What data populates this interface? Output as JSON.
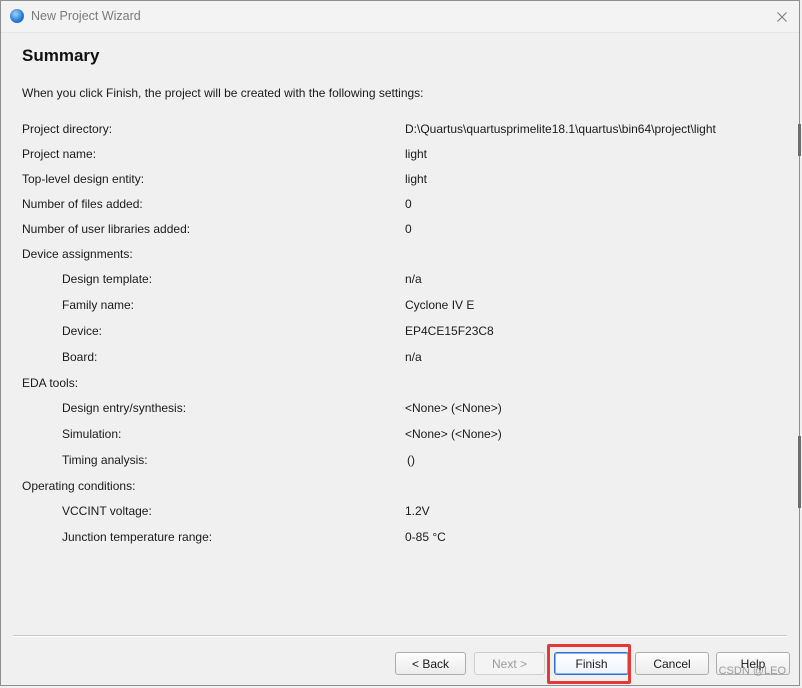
{
  "window": {
    "title": "New Project Wizard"
  },
  "page": {
    "heading": "Summary",
    "intro": "When you click Finish, the project will be created with the following settings:"
  },
  "settings": [
    {
      "label": "Project directory:",
      "value": "D:\\Quartus\\quartusprimelite18.1\\quartus\\bin64\\project\\light",
      "indent": false
    },
    {
      "label": "Project name:",
      "value": "light",
      "indent": false
    },
    {
      "label": "Top-level design entity:",
      "value": "light",
      "indent": false
    },
    {
      "label": "Number of files added:",
      "value": "0",
      "indent": false
    },
    {
      "label": "Number of user libraries added:",
      "value": "0",
      "indent": false
    },
    {
      "label": "Device assignments:",
      "value": "",
      "indent": false
    },
    {
      "label": "Design template:",
      "value": "n/a",
      "indent": true
    },
    {
      "label": "Family name:",
      "value": "Cyclone IV E",
      "indent": true
    },
    {
      "label": "Device:",
      "value": "EP4CE15F23C8",
      "indent": true
    },
    {
      "label": "Board:",
      "value": "n/a",
      "indent": true
    },
    {
      "label": "EDA tools:",
      "value": "",
      "indent": false
    },
    {
      "label": "Design entry/synthesis:",
      "value": "<None> (<None>)",
      "indent": true
    },
    {
      "label": "Simulation:",
      "value": "<None> (<None>)",
      "indent": true
    },
    {
      "label": "Timing analysis:",
      "value": "()",
      "indent": true
    },
    {
      "label": "Operating conditions:",
      "value": "",
      "indent": false
    },
    {
      "label": "VCCINT voltage:",
      "value": "1.2V",
      "indent": true
    },
    {
      "label": "Junction temperature range:",
      "value": "0-85 °C",
      "indent": true
    }
  ],
  "buttons": {
    "back": "< Back",
    "next": "Next >",
    "finish": "Finish",
    "cancel": "Cancel",
    "help": "Help"
  },
  "watermark": "CSDN @LEO",
  "colors": {
    "highlight": "#e53935",
    "default_button_border": "#2a6fd1"
  },
  "icons": {
    "app": "quartus-globe-icon",
    "close": "close-icon"
  }
}
